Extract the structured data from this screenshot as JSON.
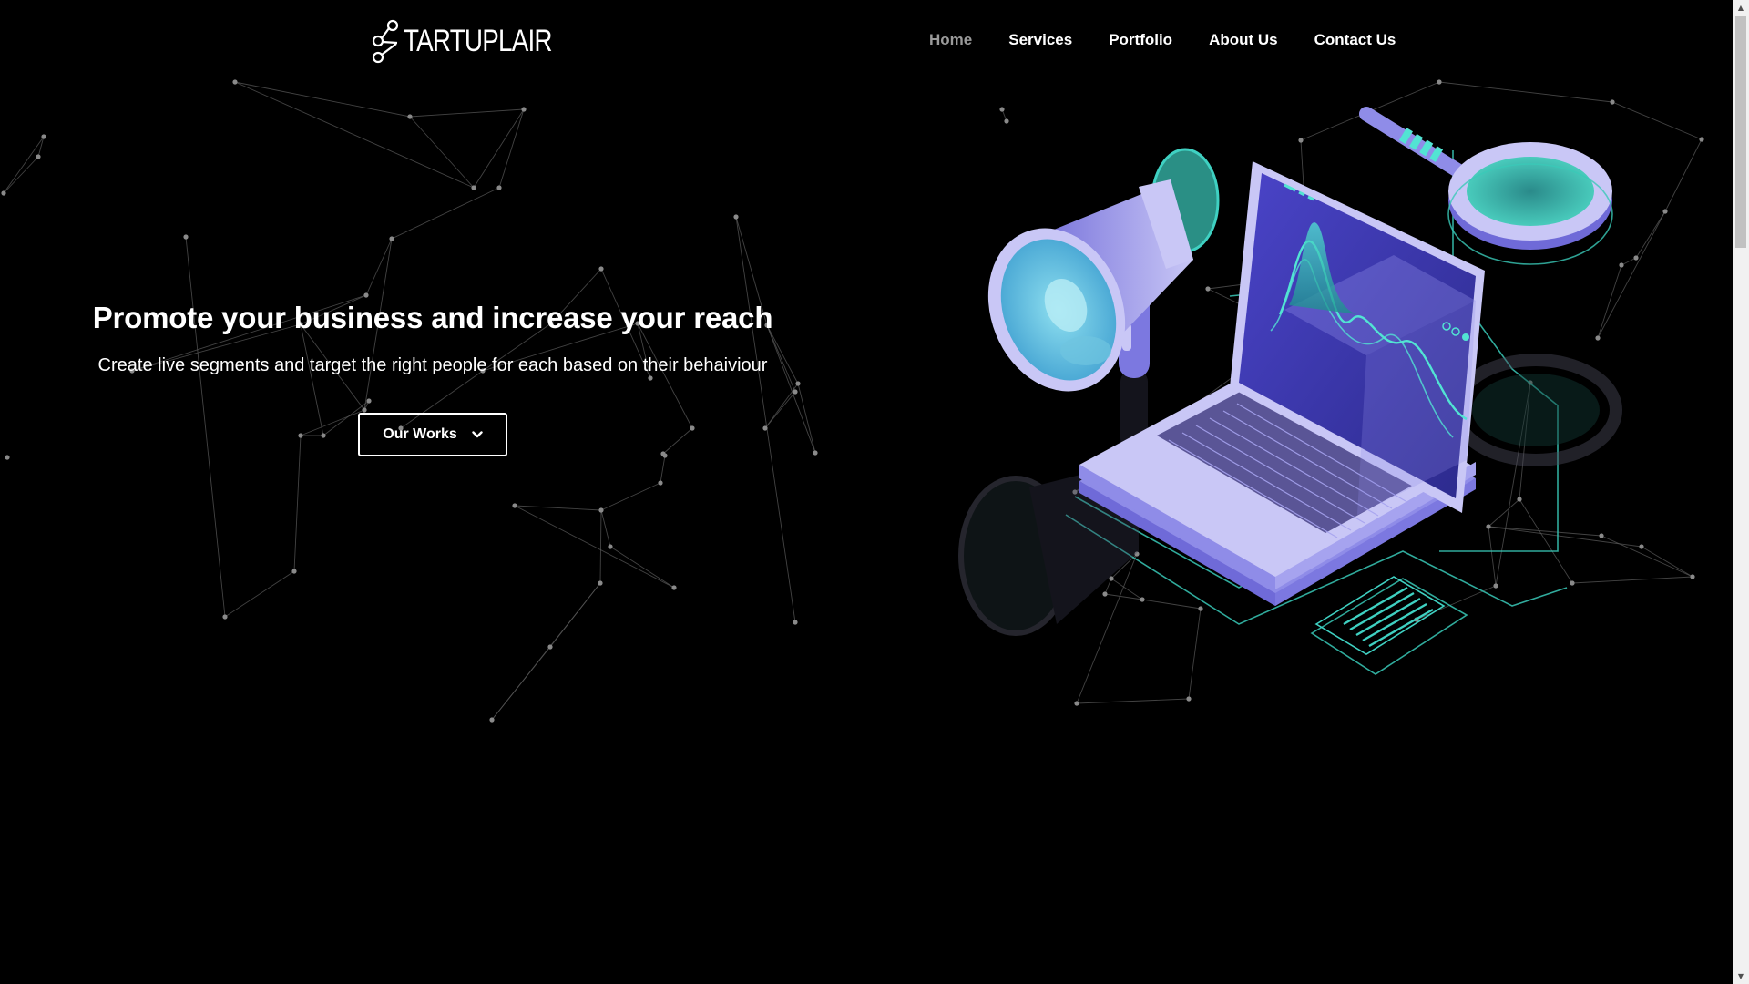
{
  "brand": {
    "name": "TARTUPLAIR",
    "logo_icon": "share-nodes-icon"
  },
  "nav": {
    "items": [
      {
        "label": "Home",
        "active": true
      },
      {
        "label": "Services",
        "active": false
      },
      {
        "label": "Portfolio",
        "active": false
      },
      {
        "label": "About Us",
        "active": false
      },
      {
        "label": "Contact Us",
        "active": false
      }
    ]
  },
  "hero": {
    "title": "Promote your business and increase your reach",
    "subtitle": "Create live segments and target the right people for each based on their behaiviour",
    "cta_label": "Our Works",
    "cta_icon": "chevron-down-icon"
  },
  "colors": {
    "background": "#000000",
    "text": "#ffffff",
    "nav_active": "#9a9a9a",
    "illustration_purple": "#8f8ce8",
    "illustration_teal": "#3fd1c2"
  }
}
